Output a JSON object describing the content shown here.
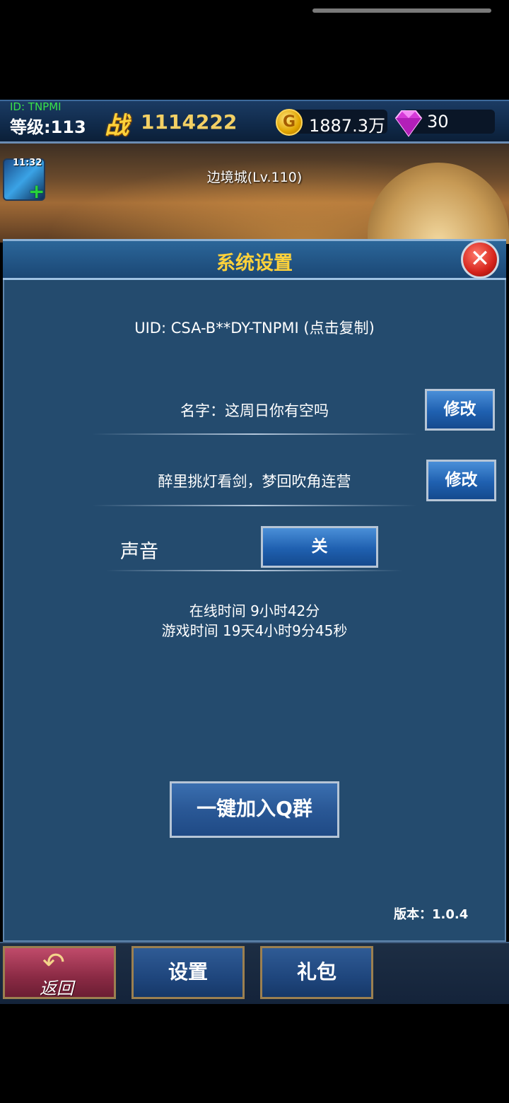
{
  "topbar": {
    "player_id": "ID: TNPMI",
    "level": "等级:113",
    "power_glyph": "战",
    "power": "1114222",
    "gold_icon_label": "G",
    "gold": "1887.3万",
    "gems": "30",
    "icons": {
      "gold": "gold-coin-icon",
      "gem": "diamond-icon",
      "power": "battle-power-icon"
    }
  },
  "scene": {
    "title": "边境城(Lv.110)",
    "skill_timer": "11:32",
    "skill_plus": "+"
  },
  "dialog": {
    "title": "系统设置",
    "close_symbol": "✕",
    "uid": "UID: CSA-B**DY-TNPMI (点击复制)",
    "name_label": "名字：这周日你有空吗",
    "edit_name_label": "修改",
    "motto_label": "醉里挑灯看剑，梦回吹角连营",
    "edit_motto_label": "修改",
    "sound_label": "声音",
    "sound_value": "关",
    "online_time": "在线时间 9小时42分",
    "play_time": "游戏时间 19天4小时9分45秒",
    "qgroup_label": "一键加入Q群",
    "version": "版本：1.0.4"
  },
  "bottom_nav": {
    "back_arrow": "↶",
    "back_label": "返回",
    "settings_label": "设置",
    "gift_label": "礼包"
  },
  "colors": {
    "accent_gold": "#ffd23a",
    "level_green": "#39e24a",
    "dialog_bg": "#244b6e",
    "button_blue": "#1f60b0",
    "back_red": "#8a2a44"
  }
}
